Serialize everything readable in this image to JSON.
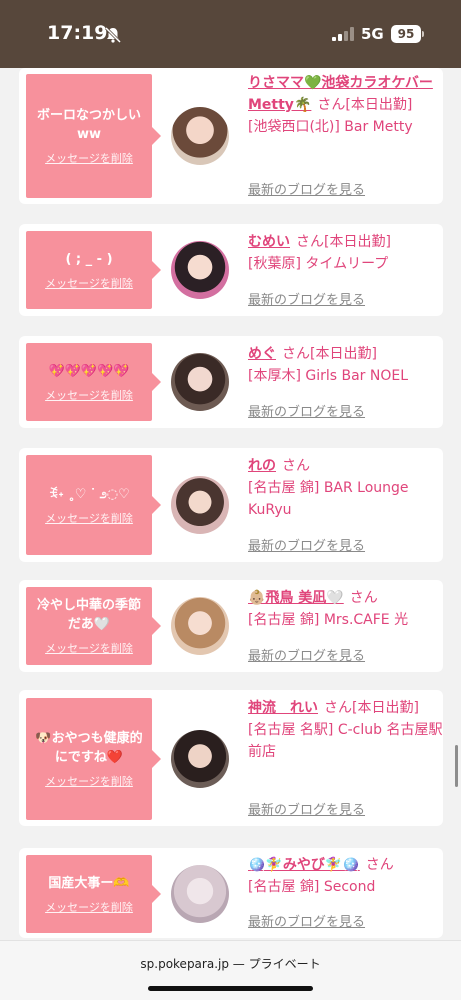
{
  "status": {
    "time": "17:19",
    "network": "5G",
    "battery": "95"
  },
  "cards": [
    {
      "message": "ボーロなつかしいww",
      "delete": "メッセージを削除",
      "name": "りさママ💚池袋カラオケバーMetty🌴",
      "san": "さん",
      "tag": "[本日出勤]",
      "shop": "[池袋西口(北)] Bar Metty",
      "blog": "最新のブログを見る"
    },
    {
      "message": "( ; _ - )",
      "delete": "メッセージを削除",
      "name": "むめい",
      "san": "さん",
      "tag": "[本日出勤]",
      "shop": "[秋葉原] タイムリープ",
      "blog": "最新のブログを見る"
    },
    {
      "message": "💖💖💖💖💖",
      "delete": "メッセージを削除",
      "name": "めぐ",
      "san": "さん",
      "tag": "[本日出勤]",
      "shop": "[本厚木] Girls Bar NOEL",
      "blog": "最新のブログを見る"
    },
    {
      "message": "ꉂ˖ ˳♡ ᐝ ೨◌♡",
      "delete": "メッセージを削除",
      "name": "れの",
      "san": "さん",
      "tag": "",
      "shop": "[名古屋 錦] BAR Lounge KuRyu",
      "blog": "最新のブログを見る"
    },
    {
      "message": "冷やし中華の季節だあ🤍",
      "delete": "メッセージを削除",
      "name": "👶🏼飛鳥 美凪🤍",
      "san": "さん",
      "tag": "",
      "shop": "[名古屋 錦] Mrs.CAFE 光",
      "blog": "最新のブログを見る"
    },
    {
      "message": "🐶おやつも健康的にですね❤️",
      "delete": "メッセージを削除",
      "name": "神流　れい",
      "san": "さん",
      "tag": "[本日出勤]",
      "shop": "[名古屋 名駅] C-club 名古屋駅前店",
      "blog": "最新のブログを見る"
    },
    {
      "message": "国産大事ー🫶",
      "delete": "メッセージを削除",
      "name": "🪩🧚‍♀️みやび🧚‍♀️🪩",
      "san": "さん",
      "tag": "",
      "shop": "[名古屋 錦] Second",
      "blog": "最新のブログを見る"
    }
  ],
  "bottom": {
    "url": "sp.pokepara.jp — プライベート"
  },
  "colors": {
    "status_bg": "#57473b",
    "bubble": "#f7919c",
    "accent": "#e0457b"
  }
}
